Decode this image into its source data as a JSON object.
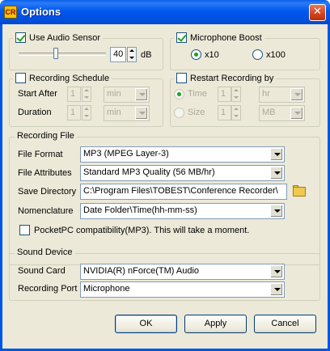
{
  "window": {
    "title": "Options",
    "app_icon": "CR",
    "close_glyph": "✕"
  },
  "audio_sensor": {
    "label": "Use Audio Sensor",
    "checked": true,
    "level": 40,
    "unit": "dB"
  },
  "microphone_boost": {
    "label": "Microphone Boost",
    "checked": true,
    "options": [
      "x10",
      "x100"
    ],
    "selected": "x10"
  },
  "recording_schedule": {
    "label": "Recording Schedule",
    "checked": false,
    "start_after": {
      "label": "Start After",
      "value": "1",
      "unit": "min"
    },
    "duration": {
      "label": "Duration",
      "value": "1",
      "unit": "min"
    }
  },
  "restart_recording": {
    "label": "Restart Recording by",
    "checked": false,
    "time": {
      "label": "Time",
      "value": "1",
      "unit": "hr"
    },
    "size": {
      "label": "Size",
      "value": "1",
      "unit": "MB"
    }
  },
  "recording_file": {
    "legend": "Recording File",
    "file_format": {
      "label": "File Format",
      "value": "MP3 (MPEG Layer-3)"
    },
    "file_attributes": {
      "label": "File Attributes",
      "value": "Standard MP3 Quality (56 MB/hr)"
    },
    "save_directory": {
      "label": "Save Directory",
      "value": "C:\\Program Files\\TOBEST\\Conference Recorder\\"
    },
    "nomenclature": {
      "label": "Nomenclature",
      "value": "Date Folder\\Time(hh-mm-ss)"
    },
    "pocketpc": {
      "label": "PocketPC compatibility(MP3). This will take a moment.",
      "checked": false
    }
  },
  "sound_device": {
    "legend": "Sound Device",
    "sound_card": {
      "label": "Sound Card",
      "value": "NVIDIA(R) nForce(TM) Audio"
    },
    "recording_port": {
      "label": "Recording Port",
      "value": "Microphone"
    }
  },
  "buttons": {
    "ok": "OK",
    "apply": "Apply",
    "cancel": "Cancel"
  },
  "icons": {
    "app": "app-logo-icon",
    "close": "close-icon",
    "folder": "folder-icon",
    "dropdown": "chevron-down-icon",
    "spin_up": "spin-up-icon",
    "spin_down": "spin-down-icon"
  },
  "colors": {
    "titlebar": "#0058ee",
    "face": "#ece9d8",
    "check": "#21a121",
    "close": "#d2421a"
  }
}
